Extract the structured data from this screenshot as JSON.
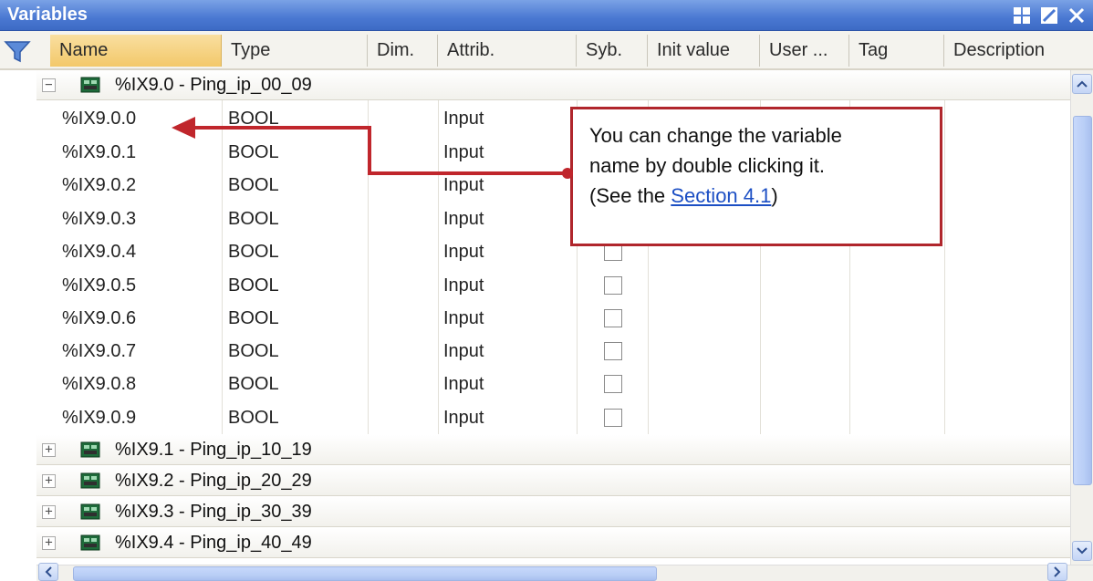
{
  "window": {
    "title": "Variables"
  },
  "columns": [
    {
      "label": "Name"
    },
    {
      "label": "Type"
    },
    {
      "label": "Dim."
    },
    {
      "label": "Attrib."
    },
    {
      "label": "Syb."
    },
    {
      "label": "Init value"
    },
    {
      "label": "User ..."
    },
    {
      "label": "Tag"
    },
    {
      "label": "Description"
    }
  ],
  "groups": [
    {
      "label": "%IX9.0 - Ping_ip_00_09",
      "expander": "−",
      "expanded": true
    },
    {
      "label": "%IX9.1 - Ping_ip_10_19",
      "expander": "+",
      "expanded": false
    },
    {
      "label": "%IX9.2 - Ping_ip_20_29",
      "expander": "+",
      "expanded": false
    },
    {
      "label": "%IX9.3 - Ping_ip_30_39",
      "expander": "+",
      "expanded": false
    },
    {
      "label": "%IX9.4 - Ping_ip_40_49",
      "expander": "+",
      "expanded": false
    }
  ],
  "variables": [
    {
      "name": "%IX9.0.0",
      "type": "BOOL",
      "attrib": "Input",
      "syb": false
    },
    {
      "name": "%IX9.0.1",
      "type": "BOOL",
      "attrib": "Input",
      "syb": false
    },
    {
      "name": "%IX9.0.2",
      "type": "BOOL",
      "attrib": "Input",
      "syb": false
    },
    {
      "name": "%IX9.0.3",
      "type": "BOOL",
      "attrib": "Input",
      "syb": false
    },
    {
      "name": "%IX9.0.4",
      "type": "BOOL",
      "attrib": "Input",
      "syb": false
    },
    {
      "name": "%IX9.0.5",
      "type": "BOOL",
      "attrib": "Input",
      "syb": false
    },
    {
      "name": "%IX9.0.6",
      "type": "BOOL",
      "attrib": "Input",
      "syb": false
    },
    {
      "name": "%IX9.0.7",
      "type": "BOOL",
      "attrib": "Input",
      "syb": false
    },
    {
      "name": "%IX9.0.8",
      "type": "BOOL",
      "attrib": "Input",
      "syb": false
    },
    {
      "name": "%IX9.0.9",
      "type": "BOOL",
      "attrib": "Input",
      "syb": false
    }
  ],
  "callout": {
    "line1": "You can change the variable",
    "line2": "name by double clicking it.",
    "line3_prefix": "(See the ",
    "link": "Section 4.1",
    "line3_suffix": ")"
  },
  "icons": {
    "filter": "filter-icon",
    "tile": "tile-icon",
    "pin": "pin-icon",
    "close": "close-icon",
    "module": "module-icon"
  },
  "colors": {
    "titlebar": "#4a78d2",
    "callout_border": "#b0262c",
    "arrow": "#c0262c",
    "link": "#1c4fc4",
    "sorted_header": "#f3c86a"
  }
}
